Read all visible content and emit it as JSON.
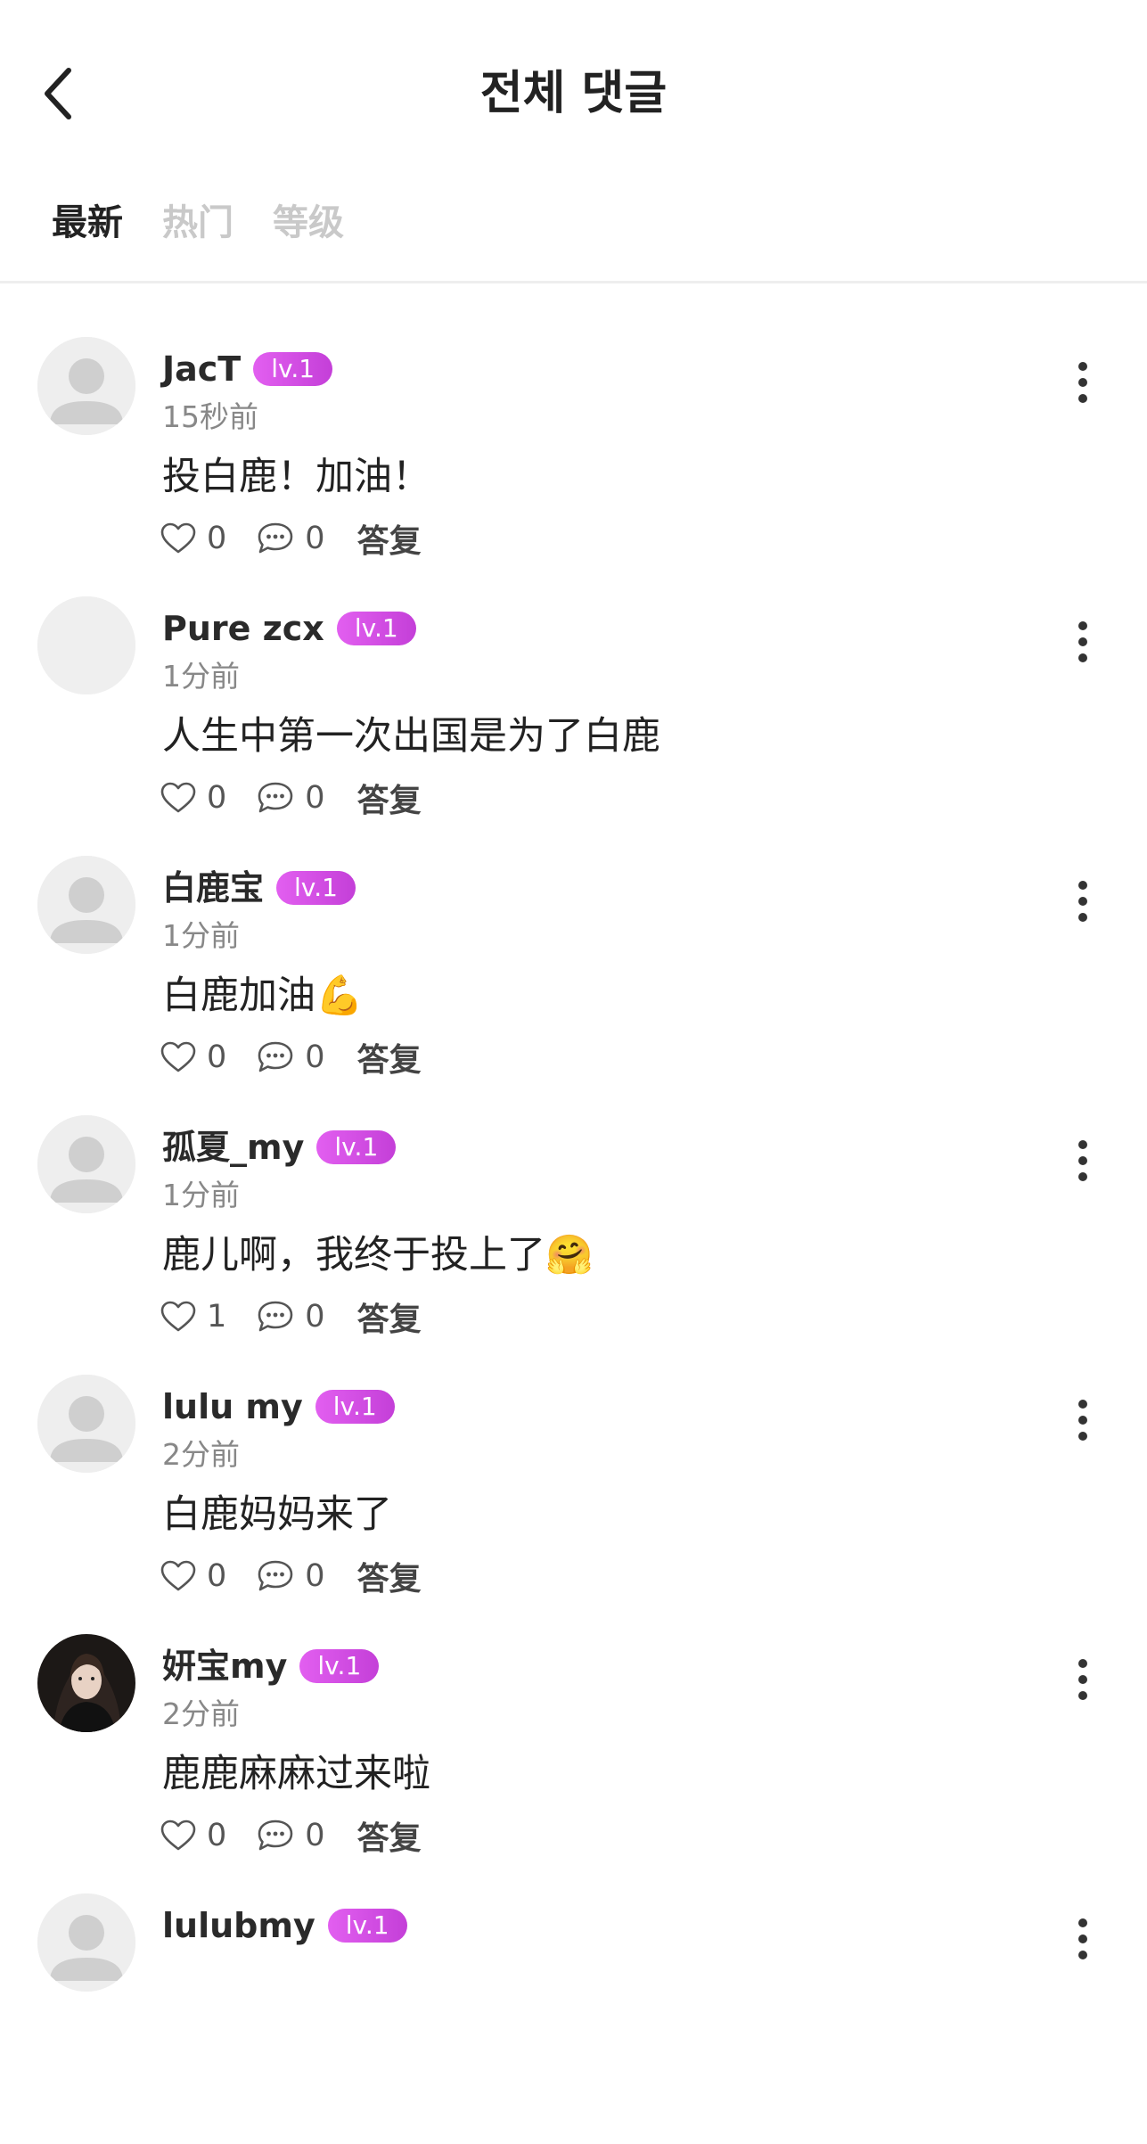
{
  "header": {
    "title": "전체 댓글"
  },
  "tabs": [
    {
      "label": "最新",
      "active": true
    },
    {
      "label": "热门",
      "active": false
    },
    {
      "label": "等级",
      "active": false
    }
  ],
  "colors": {
    "badge": "#d44ae6",
    "active_tab": "#222222",
    "inactive_tab": "#c9c9c9"
  },
  "comments": [
    {
      "username": "JacT",
      "level": "lv.1",
      "time": "15秒前",
      "text": "投白鹿！加油！",
      "likes": "0",
      "replies": "0",
      "reply_label": "答复",
      "avatar": "default-avatar"
    },
    {
      "username": "Pure zcx",
      "level": "lv.1",
      "time": "1分前",
      "text": "人生中第一次出国是为了白鹿",
      "likes": "0",
      "replies": "0",
      "reply_label": "答复",
      "avatar": "blank-avatar"
    },
    {
      "username": "白鹿宝",
      "level": "lv.1",
      "time": "1分前",
      "text": "白鹿加油💪",
      "likes": "0",
      "replies": "0",
      "reply_label": "答复",
      "avatar": "default-avatar"
    },
    {
      "username": "孤夏_my",
      "level": "lv.1",
      "time": "1分前",
      "text": "鹿儿啊，我终于投上了🤗",
      "likes": "1",
      "replies": "0",
      "reply_label": "答复",
      "avatar": "default-avatar"
    },
    {
      "username": "lulu my",
      "level": "lv.1",
      "time": "2分前",
      "text": "白鹿妈妈来了",
      "likes": "0",
      "replies": "0",
      "reply_label": "答复",
      "avatar": "default-avatar"
    },
    {
      "username": "妍宝my",
      "level": "lv.1",
      "time": "2分前",
      "text": "鹿鹿麻麻过来啦",
      "likes": "0",
      "replies": "0",
      "reply_label": "答复",
      "avatar": "photo-avatar"
    },
    {
      "username": "lulubmy",
      "level": "lv.1",
      "time": "",
      "text": "",
      "likes": "",
      "replies": "",
      "reply_label": "",
      "avatar": "default-avatar"
    }
  ]
}
